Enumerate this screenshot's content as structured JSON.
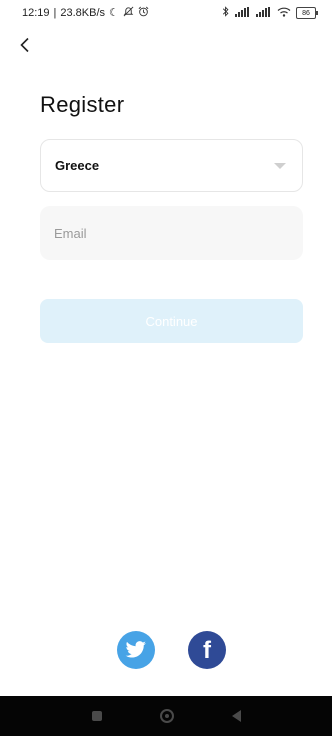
{
  "status_bar": {
    "time": "12:19",
    "separator": "|",
    "network_speed": "23.8KB/s",
    "battery_level": "86"
  },
  "header": {
    "title": "Register"
  },
  "form": {
    "country_value": "Greece",
    "email_placeholder": "Email",
    "email_value": "",
    "continue_label": "Continue"
  },
  "social": {
    "items": [
      "twitter",
      "facebook"
    ],
    "facebook_glyph": "f"
  },
  "colors": {
    "twitter": "#47a3e6",
    "facebook": "#2f4a96",
    "continue_disabled": "#dff1fa",
    "input_background": "#f7f7f7"
  },
  "icons": {
    "back": "chevron-left-icon",
    "dropdown": "triangle-down-icon",
    "nav": [
      "square-icon",
      "circle-icon",
      "triangle-left-icon"
    ]
  }
}
